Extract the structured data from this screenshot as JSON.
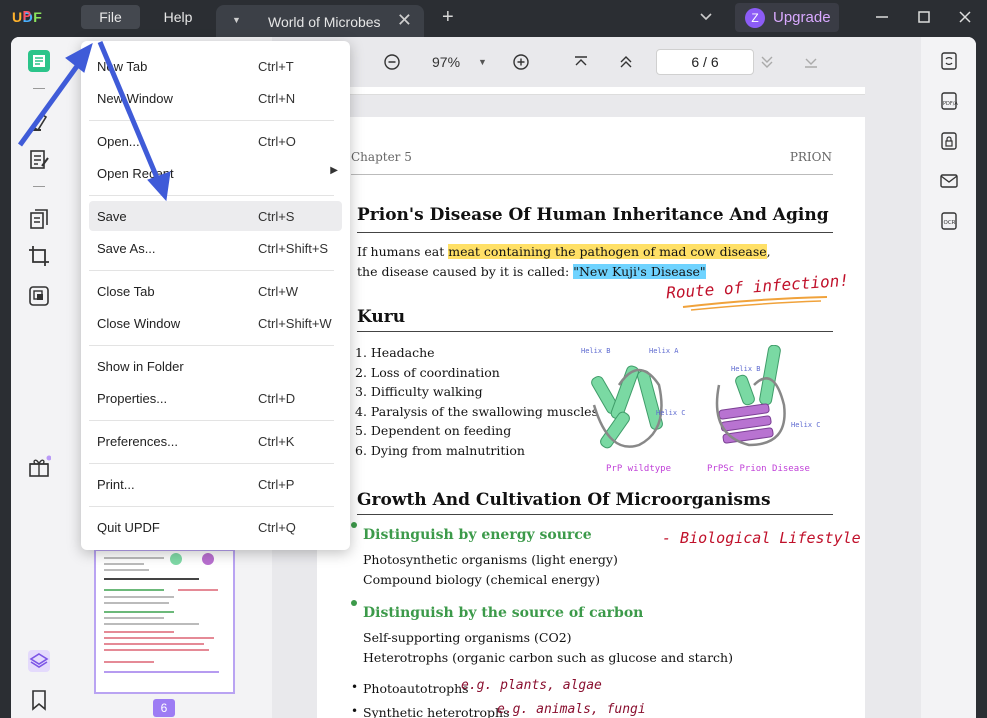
{
  "titlebar": {
    "logo": {
      "u": "U",
      "p": "P",
      "d": "D",
      "f": "F"
    },
    "menu_file": "File",
    "menu_help": "Help",
    "tab_title": "World of Microbes",
    "tab_close": "✕",
    "tab_add": "+",
    "upgrade_avatar": "Z",
    "upgrade_label": "Upgrade"
  },
  "toolbar": {
    "zoom": "97%",
    "page_indicator": "6 / 6"
  },
  "thumbnail": {
    "page_number": "6"
  },
  "file_menu": {
    "items": [
      {
        "label": "New Tab",
        "shortcut": "Ctrl+T"
      },
      {
        "label": "New Window",
        "shortcut": "Ctrl+N"
      },
      {
        "label": "Open...",
        "shortcut": "Ctrl+O"
      },
      {
        "label": "Open Recent",
        "shortcut": ""
      },
      {
        "label": "Save",
        "shortcut": "Ctrl+S"
      },
      {
        "label": "Save As...",
        "shortcut": "Ctrl+Shift+S"
      },
      {
        "label": "Close Tab",
        "shortcut": "Ctrl+W"
      },
      {
        "label": "Close Window",
        "shortcut": "Ctrl+Shift+W"
      },
      {
        "label": "Show in Folder",
        "shortcut": ""
      },
      {
        "label": "Properties...",
        "shortcut": "Ctrl+D"
      },
      {
        "label": "Preferences...",
        "shortcut": "Ctrl+K"
      },
      {
        "label": "Print...",
        "shortcut": "Ctrl+P"
      },
      {
        "label": "Quit UPDF",
        "shortcut": "Ctrl+Q"
      }
    ]
  },
  "document": {
    "header_left": "Chapter 5",
    "header_right": "PRION",
    "title1": "Prion's Disease Of Human Inheritance And Aging",
    "para1_a": "If humans eat ",
    "para1_hl": "meat containing the pathogen of mad cow disease",
    "para1_b": ",",
    "para2_a": "the disease caused by it is called: ",
    "para2_hl": "\"New Kuji's Disease\"",
    "annotation_route": "Route of infection!",
    "title2": "Kuru",
    "kuru_list": [
      "1. Headache",
      "2. Loss of coordination",
      "3. Difficulty walking",
      "4. Paralysis of the swallowing muscles",
      "5. Dependent on feeding",
      "6. Dying from malnutrition"
    ],
    "protein_labels": {
      "helix_b1": "Helix B",
      "helix_a": "Helix A",
      "helix_c1": "Helix C",
      "helix_b2": "Helix B",
      "helix_c2": "Helix C",
      "prp_wild": "PrP wildtype",
      "prp_prion": "PrPSc Prion Disease"
    },
    "title3": "Growth And Cultivation Of Microorganisms",
    "sub1": "Distinguish by energy source",
    "annotation_bio": "- Biological Lifestyle",
    "sub1_lines": [
      "Photosynthetic organisms (light energy)",
      "Compound biology (chemical energy)"
    ],
    "sub2": "Distinguish by the source of carbon",
    "sub2_lines": [
      "Self-supporting organisms (CO2)",
      "Heterotrophs (organic carbon such as glucose and starch)"
    ],
    "bullet1": "Photoautotrophs",
    "bullet1_note": "e.g. plants, algae",
    "bullet2": "Synthetic heterotrophs",
    "bullet2_note": "e.g. animals, fungi"
  },
  "colors": {
    "accent": "#9d7cf4",
    "highlight_yellow": "#ffe066",
    "highlight_blue": "#6fd3ff",
    "annotation_red": "#c0102a",
    "heading_green": "#3c9a4a",
    "arrow_blue": "#3f5bd8"
  }
}
